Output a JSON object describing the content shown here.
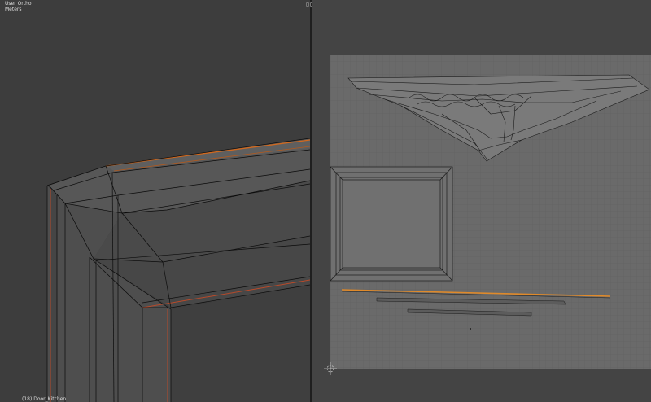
{
  "viewport": {
    "view_label": "User Ortho",
    "units_label": "Meters",
    "object_label": "(18) Door_Kitchen"
  },
  "colors": {
    "viewport_bg": "#3d3d3d",
    "mesh_face": "#4a4a4a",
    "wire": "#0b0b0b",
    "seam": "#d2691e",
    "uv_grid_bg": "#6a6a6a",
    "uv_grid_line": "#5e5e5e",
    "uv_wire": "#1a1a1a",
    "uv_highlight": "#e08a2a"
  },
  "icons": {
    "split_handle": "area-split-icon",
    "cursor": "2d-cursor-icon"
  }
}
